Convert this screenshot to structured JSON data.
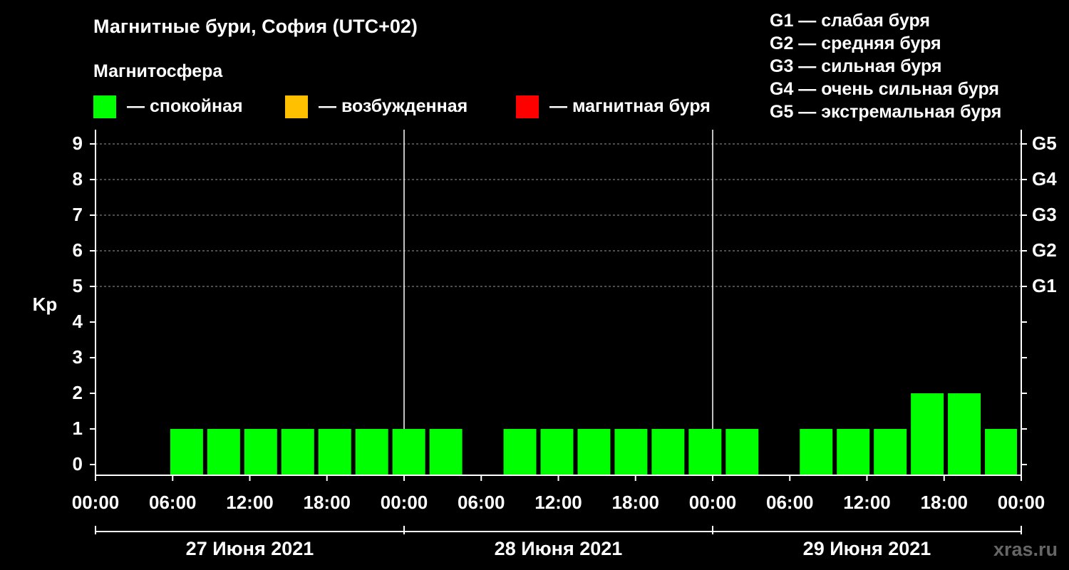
{
  "title": "Магнитные бури, София (UTC+02)",
  "subtitle": "Магнитосфера",
  "legend": [
    {
      "label": "— спокойная",
      "color": "#00ff00"
    },
    {
      "label": "— возбужденная",
      "color": "#ffc000"
    },
    {
      "label": "— магнитная буря",
      "color": "#ff0000"
    }
  ],
  "g_legend": [
    "G1 — слабая буря",
    "G2 — средняя буря",
    "G3 — сильная буря",
    "G4 — очень сильная буря",
    "G5 — экстремальная буря"
  ],
  "watermark": "xras.ru",
  "chart_data": {
    "type": "bar",
    "ylabel": "Kp",
    "ylim": [
      0,
      9
    ],
    "yticks": [
      0,
      1,
      2,
      3,
      4,
      5,
      6,
      7,
      8,
      9
    ],
    "right_ticks": [
      {
        "kp": 5,
        "label": "G1"
      },
      {
        "kp": 6,
        "label": "G2"
      },
      {
        "kp": 7,
        "label": "G3"
      },
      {
        "kp": 8,
        "label": "G4"
      },
      {
        "kp": 9,
        "label": "G5"
      }
    ],
    "grid": true,
    "xticks": [
      "00:00",
      "06:00",
      "12:00",
      "18:00",
      "00:00",
      "06:00",
      "12:00",
      "18:00",
      "00:00",
      "06:00",
      "12:00",
      "18:00",
      "00:00"
    ],
    "days": [
      "27 Июня 2021",
      "28 Июня 2021",
      "29 Июня 2021"
    ],
    "interval_hours": 3,
    "bar_color": "#00ff00",
    "values": [
      0,
      0,
      1,
      1,
      1,
      1,
      1,
      1,
      1,
      1,
      0,
      1,
      1,
      1,
      1,
      1,
      1,
      1,
      0,
      1,
      1,
      1,
      2,
      2,
      1
    ]
  }
}
